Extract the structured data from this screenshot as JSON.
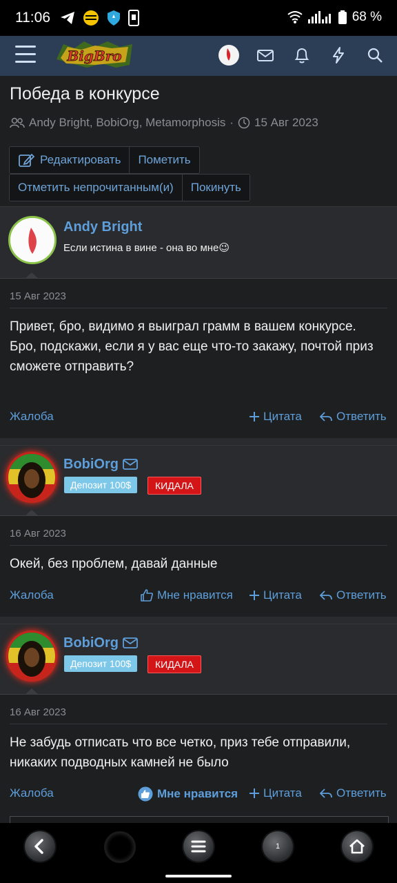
{
  "status_bar": {
    "time": "11:06",
    "battery": "68 %",
    "icons": [
      "telegram-icon",
      "beeline-icon",
      "vpn-shield-icon",
      "phone-icon",
      "wifi-icon",
      "signal-icon",
      "battery-icon"
    ]
  },
  "app_bar": {
    "logo_text": "BigBro",
    "icons": [
      "menu-icon",
      "profile-avatar",
      "mail-icon",
      "bell-icon",
      "lightning-icon",
      "search-icon"
    ]
  },
  "thread": {
    "title": "Победа в конкурсе",
    "participants": "Andy Bright, BobiOrg, Metamorphosis",
    "separator": "·",
    "date": "15 Авг 2023",
    "buttons": {
      "edit": "Редактировать",
      "mark": "Пометить",
      "mark_unread": "Отметить непрочитанным(и)",
      "leave": "Покинуть"
    }
  },
  "posts": [
    {
      "username": "Andy Bright",
      "user_title": "Если истина в вине - она во мне😉",
      "date": "15 Авг 2023",
      "message_lines": [
        "Привет, бро, видимо я выиграл грамм в вашем конкурсе.",
        "Бро, подскажи, если я у вас еще что-то закажу, почтой приз сможете отправить?"
      ],
      "actions": {
        "report": "Жалоба",
        "quote": "Цитата",
        "reply": "Ответить"
      }
    },
    {
      "username": "BobiOrg",
      "badges": [
        "Депозит 100$",
        "КИДАЛА"
      ],
      "date": "16 Авг 2023",
      "message": "Окей, без проблем, давай данные",
      "actions": {
        "report": "Жалоба",
        "like": "Мне нравится",
        "quote": "Цитата",
        "reply": "Ответить"
      }
    },
    {
      "username": "BobiOrg",
      "badges": [
        "Депозит 100$",
        "КИДАЛА"
      ],
      "date": "16 Авг 2023",
      "message": "Не забудь отписать что все четко, приз тебе отправили, никаких подводных камней не было",
      "actions": {
        "report": "Жалоба",
        "like": "Мне нравится",
        "quote": "Цитата",
        "reply": "Ответить"
      }
    }
  ],
  "bottom_nav": {
    "page_badge": "1",
    "buttons": [
      "back-button",
      "loading-indicator",
      "menu-button",
      "page-button",
      "home-button"
    ]
  },
  "colors": {
    "accent": "#5e9fdb",
    "header": "#2c3e56",
    "background": "#1e1f21",
    "danger_badge": "#d31518",
    "deposit_badge": "#7dc8e8"
  }
}
